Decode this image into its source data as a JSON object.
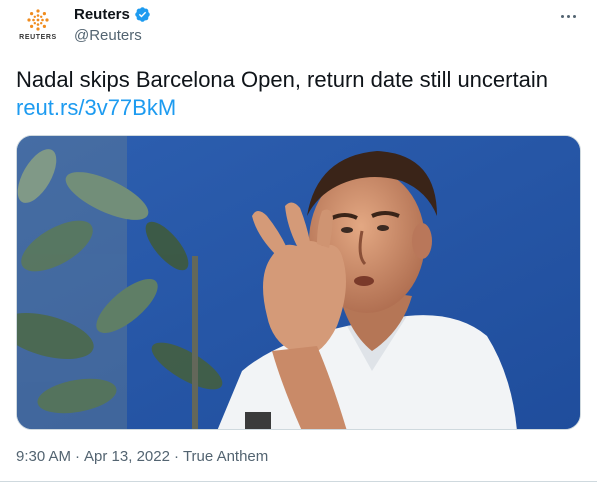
{
  "account": {
    "display_name": "Reuters",
    "handle": "@Reuters",
    "logo_text": "REUTERS",
    "verified_icon": "verified-badge-icon"
  },
  "more_icon": "more-options-icon",
  "tweet": {
    "text": "Nadal skips Barcelona Open, return date still uncertain",
    "link": "reut.rs/3v77BkM"
  },
  "media": {
    "description_icon": "photo"
  },
  "meta": {
    "time": "9:30 AM",
    "separator": "·",
    "date": "Apr 13, 2022",
    "source": "True Anthem"
  },
  "colors": {
    "accent": "#1d9bf0",
    "logo_orange": "#f08c1e",
    "muted": "#536471"
  }
}
